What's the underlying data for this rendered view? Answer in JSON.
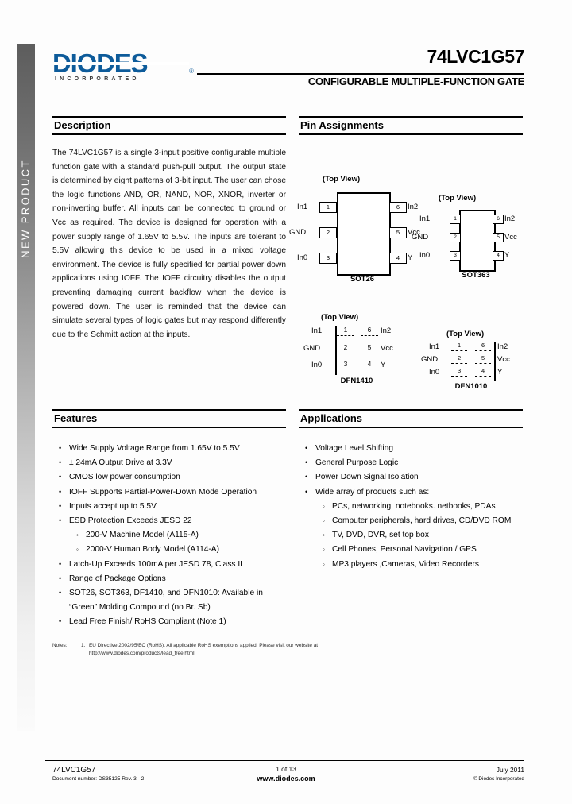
{
  "sidebar": {
    "status_label": "NEW PRODUCT"
  },
  "header": {
    "logo_word": "DIODES",
    "logo_sub": "INCORPORATED",
    "logo_registered": "®",
    "part_number": "74LVC1G57",
    "subtitle": "CONFIGURABLE MULTIPLE-FUNCTION GATE"
  },
  "description": {
    "title": "Description",
    "text": "The 74LVC1G57 is a single 3-input positive configurable multiple function gate with a standard push-pull output.  The output state is determined by eight patterns of 3-bit input.  The user can chose the logic functions AND, OR, NAND, NOR, XNOR, inverter or non-inverting buffer.  All inputs can be connected to ground or Vcc as required.  The device is designed for operation with a power supply range of 1.65V to 5.5V.  The inputs are tolerant to 5.5V allowing this device to be used in a mixed voltage environment.  The device is fully specified for partial power down applications using IOFF.  The IOFF circuitry disables the output preventing damaging current backflow when the device is powered down.  The user is reminded that the device can simulate several types of logic gates but may respond differently due to the Schmitt action at the inputs."
  },
  "pin_assignments": {
    "title": "Pin Assignments",
    "top_view_label": "(Top View)",
    "packages": [
      {
        "name": "SOT26",
        "left_pins": [
          {
            "num": "1",
            "label": "In1"
          },
          {
            "num": "2",
            "label": "GND"
          },
          {
            "num": "3",
            "label": "In0"
          }
        ],
        "right_pins": [
          {
            "num": "6",
            "label": "In2"
          },
          {
            "num": "5",
            "label": "Vcc"
          },
          {
            "num": "4",
            "label": "Y"
          }
        ]
      },
      {
        "name": "SOT363",
        "left_pins": [
          {
            "num": "1",
            "label": "In1"
          },
          {
            "num": "2",
            "label": "GND"
          },
          {
            "num": "3",
            "label": "In0"
          }
        ],
        "right_pins": [
          {
            "num": "6",
            "label": "In2"
          },
          {
            "num": "5",
            "label": "Vcc"
          },
          {
            "num": "4",
            "label": "Y"
          }
        ]
      },
      {
        "name": "DFN1410",
        "left_pins": [
          {
            "num": "1",
            "label": "In1"
          },
          {
            "num": "2",
            "label": "GND"
          },
          {
            "num": "3",
            "label": "In0"
          }
        ],
        "right_pins": [
          {
            "num": "6",
            "label": "In2"
          },
          {
            "num": "5",
            "label": "Vcc"
          },
          {
            "num": "4",
            "label": "Y"
          }
        ]
      },
      {
        "name": "DFN1010",
        "left_pins": [
          {
            "num": "1",
            "label": "In1"
          },
          {
            "num": "2",
            "label": "GND"
          },
          {
            "num": "3",
            "label": "In0"
          }
        ],
        "right_pins": [
          {
            "num": "6",
            "label": "In2"
          },
          {
            "num": "5",
            "label": "Vcc"
          },
          {
            "num": "4",
            "label": "Y"
          }
        ]
      }
    ]
  },
  "features": {
    "title": "Features",
    "items": [
      "Wide Supply Voltage Range from 1.65V to 5.5V",
      "± 24mA Output Drive at 3.3V",
      "CMOS low power consumption",
      "IOFF Supports Partial-Power-Down Mode Operation",
      "Inputs accept up to 5.5V",
      "ESD Protection Exceeds JESD 22"
    ],
    "esd_subitems": [
      "200-V Machine Model (A115-A)",
      "2000-V Human Body Model (A114-A)"
    ],
    "items_after": [
      "Latch-Up Exceeds 100mA per JESD 78, Class II",
      "Range of Package Options"
    ],
    "green_item_line1": "SOT26, SOT363, DF1410, and DFN1010: Available in",
    "green_item_line2": "“Green” Molding Compound (no Br. Sb)",
    "last_item": "Lead Free Finish/ RoHS Compliant (Note 1)"
  },
  "applications": {
    "title": "Applications",
    "items": [
      "Voltage Level Shifting",
      "General Purpose Logic",
      "Power Down Signal Isolation",
      "Wide array of products such as:"
    ],
    "subitems": [
      "PCs, networking, notebooks. netbooks, PDAs",
      "Computer peripherals, hard drives, CD/DVD ROM",
      "TV, DVD, DVR, set top box",
      "Cell Phones, Personal Navigation / GPS",
      "MP3 players ,Cameras, Video Recorders"
    ]
  },
  "notes": {
    "label": "Notes:",
    "number": "1.",
    "line1": "EU Directive 2002/95/EC (RoHS). All applicable RoHS exemptions applied. Please visit our website at",
    "line2": "http://www.diodes.com/products/lead_free.html."
  },
  "footer": {
    "left_part": "74LVC1G57",
    "left_doc": "Document number: DS35125 Rev. 3 - 2",
    "center_page": "1 of 13",
    "center_site": "www.diodes.com",
    "right_date": "July 2011",
    "right_copy": "© Diodes Incorporated"
  },
  "colors": {
    "brand_blue": "#0d5b9a",
    "rule_black": "#000000",
    "band_top": "#5d5d5d"
  }
}
